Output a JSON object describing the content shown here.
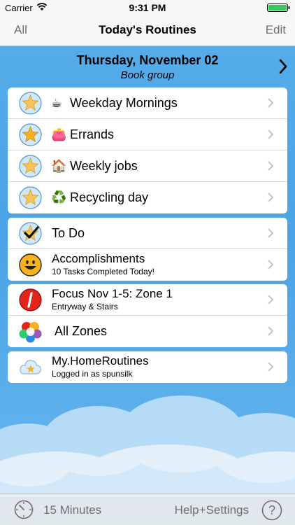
{
  "status_bar": {
    "carrier": "Carrier",
    "time": "9:31 PM"
  },
  "nav": {
    "left": "All",
    "title": "Today's Routines",
    "right": "Edit"
  },
  "date": {
    "line": "Thursday, November 02",
    "subtitle": "Book group"
  },
  "routines": [
    {
      "emoji": "☕",
      "label": "Weekday Mornings"
    },
    {
      "emoji": "👛",
      "label": "Errands"
    },
    {
      "emoji": "🏠",
      "label": "Weekly jobs"
    },
    {
      "emoji": "♻️",
      "label": "Recycling day"
    }
  ],
  "tasks": {
    "todo": "To Do",
    "accomplishments": {
      "title": "Accomplishments",
      "subtitle": "10 Tasks Completed Today!"
    }
  },
  "zones": {
    "focus": {
      "title": "Focus Nov 1-5: Zone 1",
      "subtitle": "Entryway & Stairs"
    },
    "all": "All Zones"
  },
  "account": {
    "title": "My.HomeRoutines",
    "subtitle": "Logged in as spunsilk"
  },
  "bottom": {
    "timer": "15 Minutes",
    "help": "Help+Settings"
  },
  "colors": {
    "sky": "#4aa3e6",
    "star": "#f7b21c",
    "focus": "#e2241c"
  }
}
